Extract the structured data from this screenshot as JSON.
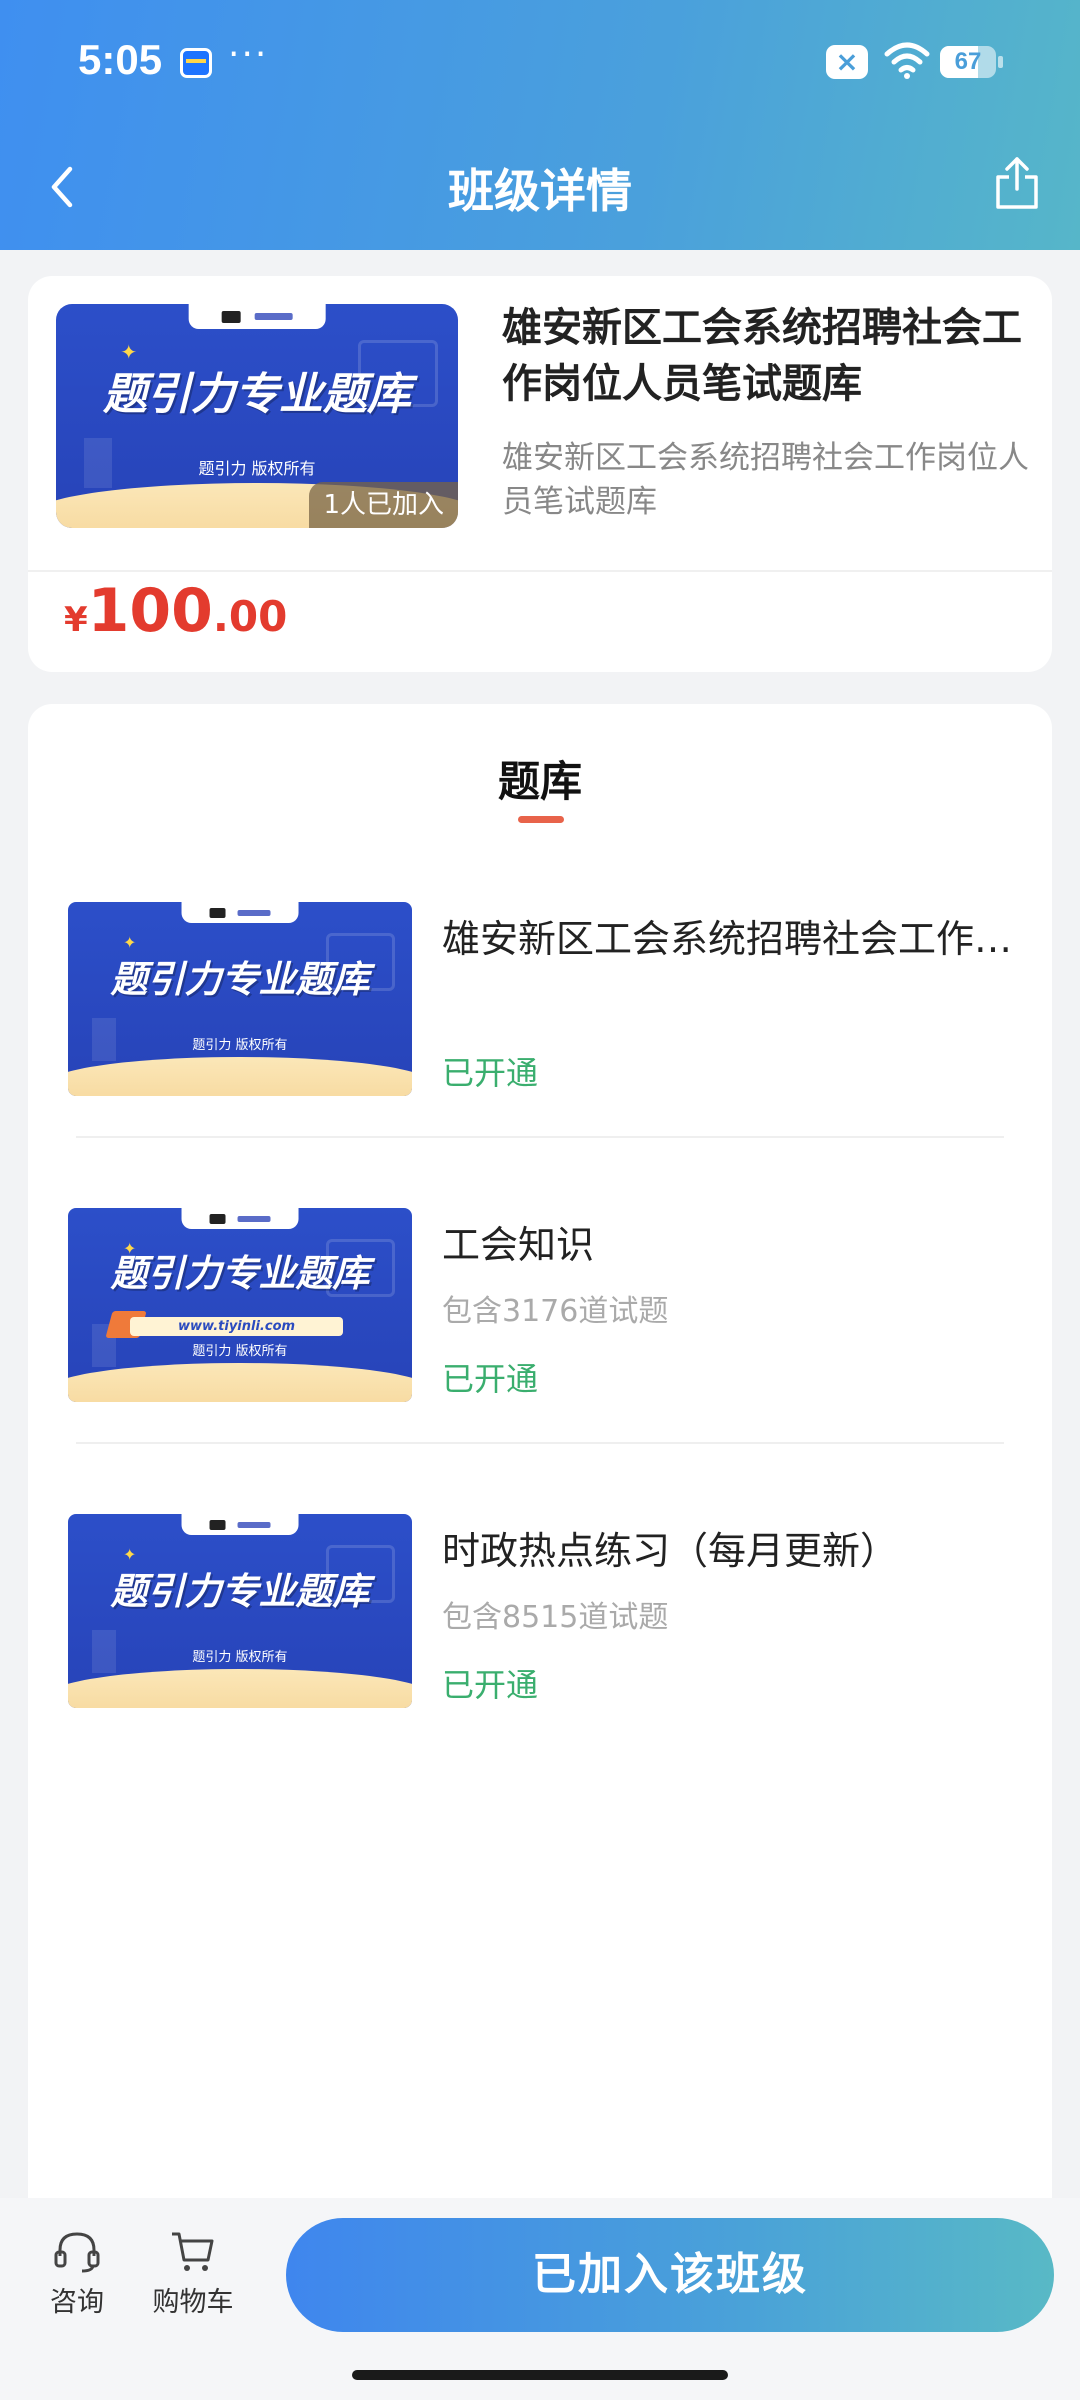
{
  "status_bar": {
    "time": "5:05",
    "dots": "···",
    "battery": "67",
    "battery_level": 0.67,
    "close_badge": "×"
  },
  "nav": {
    "title": "班级详情",
    "back_icon": "chevron-left-icon",
    "share_icon": "share-icon"
  },
  "class_info": {
    "cover_banner": "题引力专业题库",
    "cover_copyright": "题引力 版权所有",
    "joined_badge": "1人已加入",
    "title": "雄安新区工会系统招聘社会工作岗位人员笔试题库",
    "subtitle": "雄安新区工会系统招聘社会工作岗位人员笔试题库",
    "price_symbol": "¥",
    "price_integer": "100",
    "price_decimal": ".00"
  },
  "bank_section": {
    "title": "题库",
    "items": [
      {
        "cover_banner": "题引力专业题库",
        "cover_copyright": "题引力 版权所有",
        "name": "雄安新区工会系统招聘社会工作岗位人员笔试题库",
        "count": "",
        "status": "已开通"
      },
      {
        "cover_banner": "题引力专业题库",
        "cover_copyright": "题引力 版权所有",
        "cover_url": "www.tiyinli.com",
        "name": "工会知识",
        "count": "包含3176道试题",
        "status": "已开通"
      },
      {
        "cover_banner": "题引力专业题库",
        "cover_copyright": "题引力 版权所有",
        "name": "时政热点练习（每月更新）",
        "count": "包含8515道试题",
        "status": "已开通"
      }
    ]
  },
  "bottom_bar": {
    "consult_label": "咨询",
    "cart_label": "购物车",
    "join_button": "已加入该班级"
  },
  "colors": {
    "header_start": "#3f8ff0",
    "header_end": "#56b6c9",
    "price": "#e33b2e",
    "status_open": "#3aae6e",
    "tab_underline": "#e8634a"
  }
}
